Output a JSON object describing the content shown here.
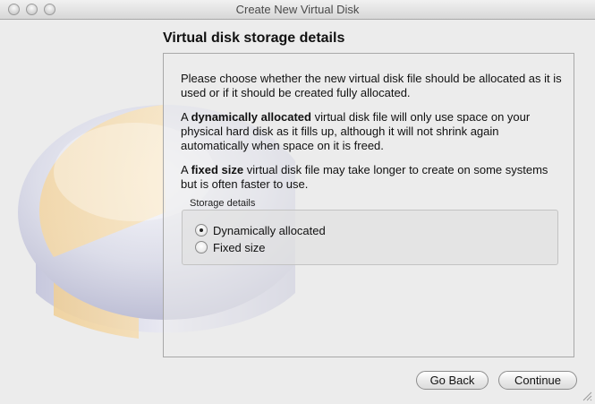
{
  "window": {
    "title": "Create New Virtual Disk"
  },
  "page": {
    "heading": "Virtual disk storage details",
    "intro": "Please choose whether the new virtual disk file should be allocated as it is used or if it should be created fully allocated.",
    "dynamic_prefix": "A ",
    "dynamic_bold": "dynamically allocated",
    "dynamic_rest": " virtual disk file will only use space on your physical hard disk as it fills up, although it will not shrink again automatically when space on it is freed.",
    "fixed_prefix": "A ",
    "fixed_bold": "fixed size",
    "fixed_rest": " virtual disk file may take longer to create on some systems but is often faster to use."
  },
  "storage": {
    "group_label": "Storage details",
    "options": [
      {
        "label": "Dynamically allocated",
        "selected": true
      },
      {
        "label": "Fixed size",
        "selected": false
      }
    ]
  },
  "buttons": {
    "back": "Go Back",
    "continue": "Continue"
  },
  "icons": {
    "window_controls": [
      "close-icon",
      "minimize-icon",
      "zoom-icon"
    ],
    "background_art": "disk-pie-illustration",
    "resize": "resize-grip-icon"
  }
}
